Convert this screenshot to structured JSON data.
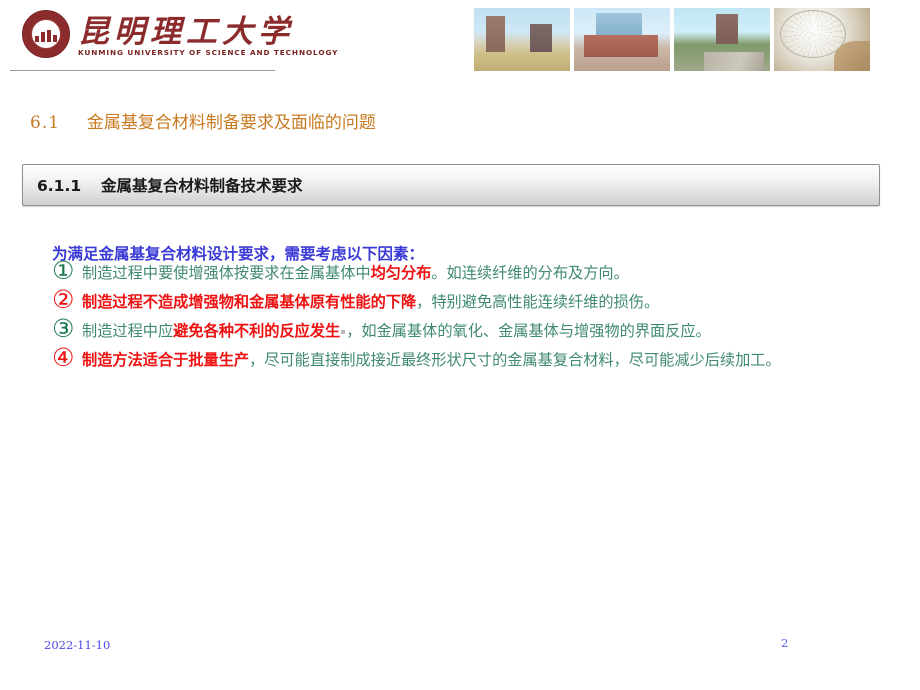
{
  "header": {
    "logo": {
      "chinese_name": "昆明理工大学",
      "english_name": "KUNMING UNIVERSITY OF SCIENCE AND TECHNOLOGY",
      "seal_color": "#8c2b2b"
    },
    "photos": [
      {
        "caption": "campus-towers-field"
      },
      {
        "caption": "campus-main-building"
      },
      {
        "caption": "campus-road-trees"
      },
      {
        "caption": "campus-glass-dome"
      }
    ]
  },
  "section": {
    "number": "6.1",
    "title": "金属基复合材料制备要求及面临的问题",
    "color": "#c87a22"
  },
  "subsection": {
    "number": "6.1.1",
    "title": "金属基复合材料制备技术要求"
  },
  "content": {
    "lead": "为满足金属基复合材料设计要求，需要考虑以下因素：",
    "lead_color": "#3a3ad6",
    "items": [
      {
        "marker": "①",
        "marker_color": "green",
        "part1": "制造过程中要使增强体按要求在金属基体中",
        "highlight": "均匀分布",
        "part2": "。如连续纤维的分布及方向。"
      },
      {
        "marker": "②",
        "marker_color": "red",
        "part1": "",
        "highlight": "制造过程不造成增强物和金属基体原有性能的下降",
        "part2": "，特别避免高性能连续纤维的损伤。"
      },
      {
        "marker": "③",
        "marker_color": "green",
        "part1": "制造过程中应",
        "highlight": "避免各种不利的反应发生",
        "part2": "，如金属基体的氧化、金属基体与增强物的界面反应。"
      },
      {
        "marker": "④",
        "marker_color": "red",
        "part1": "",
        "highlight": "制造方法适合于批量生产",
        "part2": "，尽可能直接制成接近最终形状尺寸的金属基复合材料，尽可能减少后续加工。"
      }
    ]
  },
  "footer": {
    "date": "2022-11-10",
    "page_number": "2"
  }
}
